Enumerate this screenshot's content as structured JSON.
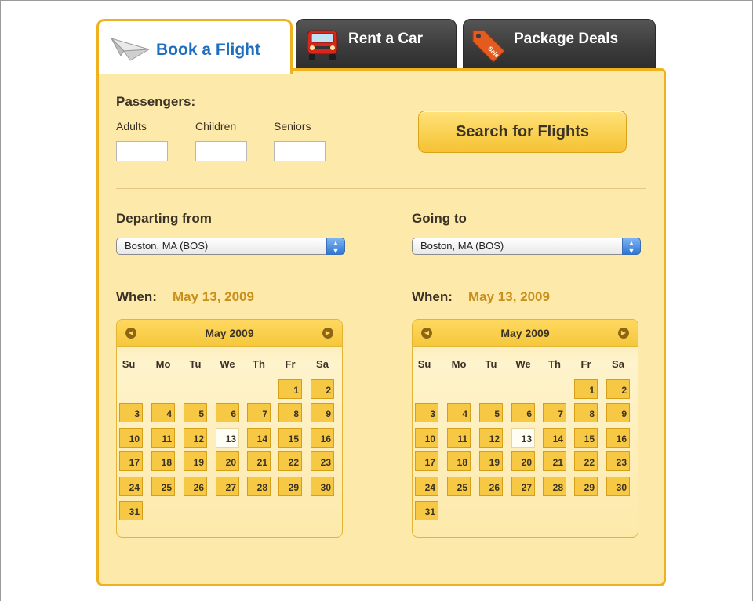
{
  "tabs": [
    {
      "label": "Book a Flight",
      "icon": "paper-plane-icon",
      "active": true
    },
    {
      "label": "Rent a Car",
      "icon": "red-car-icon",
      "active": false
    },
    {
      "label": "Package Deals",
      "icon": "sale-tag-icon",
      "active": false
    }
  ],
  "sale_tag_text": "Sale",
  "passengers": {
    "title": "Passengers:",
    "adults_label": "Adults",
    "children_label": "Children",
    "seniors_label": "Seniors",
    "adults_value": "",
    "children_value": "",
    "seniors_value": ""
  },
  "search_button_label": "Search for Flights",
  "departing": {
    "label": "Departing from",
    "value": "Boston, MA (BOS)",
    "when_label": "When:",
    "when_date": "May 13, 2009"
  },
  "going": {
    "label": "Going to",
    "value": "Boston, MA (BOS)",
    "when_label": "When:",
    "when_date": "May 13, 2009"
  },
  "calendar": {
    "month_title": "May 2009",
    "weekdays": [
      "Su",
      "Mo",
      "Tu",
      "We",
      "Th",
      "Fr",
      "Sa"
    ],
    "first_weekday_index": 5,
    "days_in_month": 31,
    "selected_day": 13
  },
  "colors": {
    "panel_bg": "#fde9aa",
    "panel_border": "#f0b11e",
    "active_tab_text": "#1f6fc0",
    "date_highlight": "#c8901a",
    "day_cell": "#f7c843"
  }
}
